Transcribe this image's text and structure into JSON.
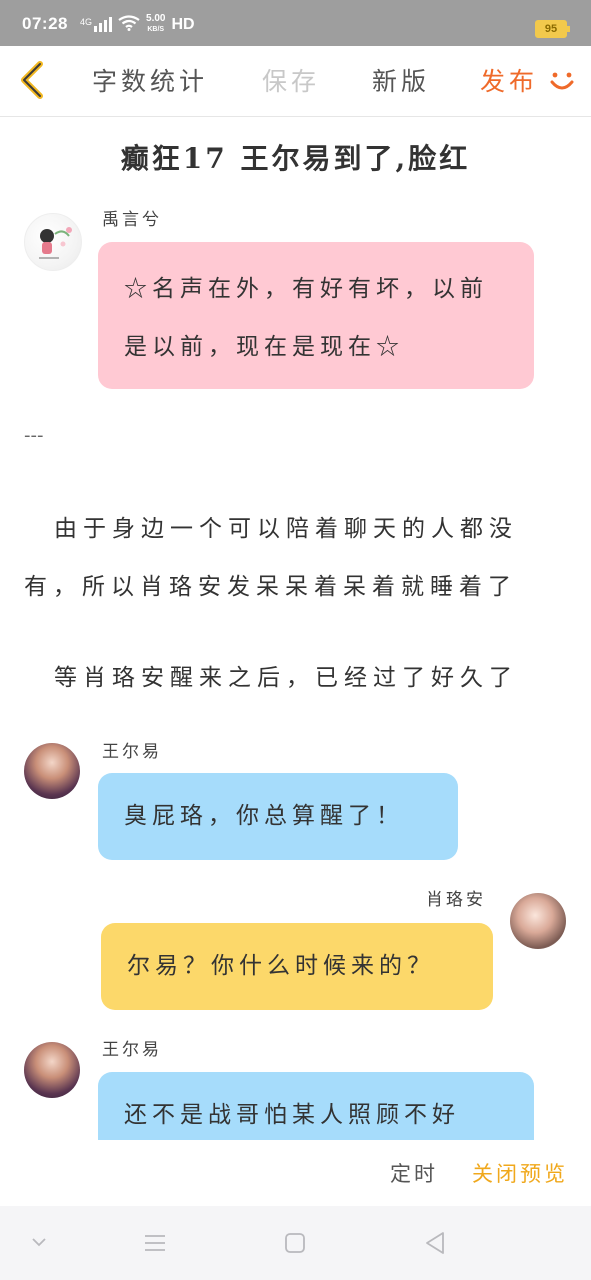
{
  "status_bar": {
    "time": "07:28",
    "signal": "4G",
    "net_speed_value": "5.00",
    "net_speed_unit": "KB/S",
    "hd": "HD",
    "battery": "95"
  },
  "toolbar": {
    "word_count_label": "字数统计",
    "save_label": "保存",
    "new_version_label": "新版",
    "publish_label": "发布"
  },
  "chapter": {
    "title": "癫狂17  王尔易到了,脸红"
  },
  "messages": [
    {
      "speaker": "禹言兮",
      "text": "☆名声在外，有好有坏，以前是以前，现在是现在☆"
    },
    {
      "speaker": "王尔易",
      "text": "臭屁珞，你总算醒了！"
    },
    {
      "speaker": "肖珞安",
      "text": "尔易？你什么时候来的？"
    },
    {
      "speaker": "王尔易",
      "text": "还不是战哥怕某人照顾不好"
    }
  ],
  "divider": "---",
  "paragraphs": [
    "由于身边一个可以陪着聊天的人都没有，所以肖珞安发呆呆着呆着就睡着了",
    "等肖珞安醒来之后，已经过了好久了"
  ],
  "actions": {
    "timer_label": "定时",
    "close_preview_label": "关闭预览"
  },
  "colors": {
    "accent_publish": "#ef6a2a",
    "accent_close": "#f0a81c",
    "bubble_pink": "#ffc9d3",
    "bubble_blue": "#a6dcfb",
    "bubble_yellow": "#fcd86a"
  }
}
